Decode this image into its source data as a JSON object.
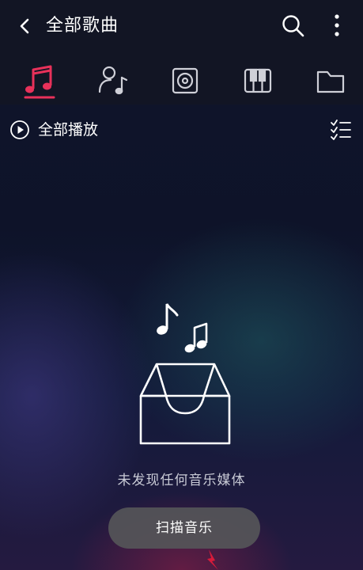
{
  "header": {
    "title": "全部歌曲",
    "back_icon": "back-arrow-icon",
    "search_icon": "search-icon",
    "more_icon": "more-vertical-icon"
  },
  "tabs": [
    {
      "name": "songs",
      "icon": "music-note-icon",
      "active": true
    },
    {
      "name": "artists",
      "icon": "singer-icon",
      "active": false
    },
    {
      "name": "albums",
      "icon": "album-icon",
      "active": false
    },
    {
      "name": "genres",
      "icon": "piano-icon",
      "active": false
    },
    {
      "name": "folders",
      "icon": "folder-icon",
      "active": false
    }
  ],
  "toolbar": {
    "play_all_label": "全部播放",
    "play_icon": "play-circle-icon",
    "multi_select_icon": "checklist-icon"
  },
  "empty_state": {
    "message": "未发现任何音乐媒体",
    "illustration": "empty-box-with-notes-icon"
  },
  "scan_button": {
    "label": "扫描音乐"
  },
  "colors": {
    "accent": "#e8315a",
    "header_bg": "#121524",
    "button_bg": "#555558"
  }
}
